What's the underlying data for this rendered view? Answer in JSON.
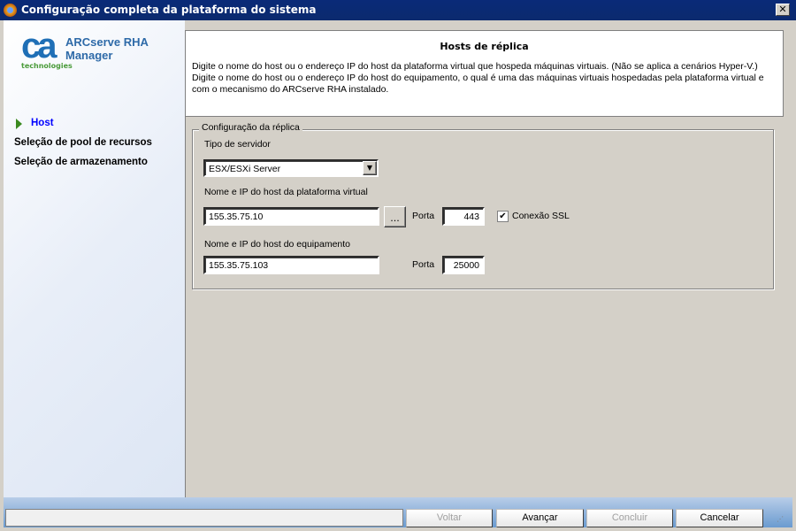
{
  "window": {
    "title": "Configuração completa da plataforma do sistema",
    "close": "✕"
  },
  "logo": {
    "brand": "ca",
    "sub": "technologies"
  },
  "product": {
    "line1": "ARCserve RHA",
    "line2": "Manager"
  },
  "steps": [
    {
      "label": "Host",
      "active": true
    },
    {
      "label": "Seleção de pool de recursos"
    },
    {
      "label": "Seleção de armazenamento"
    }
  ],
  "header": {
    "title": "Hosts de réplica",
    "description": "Digite o nome do host ou o endereço IP do host da plataforma virtual que hospeda máquinas virtuais. (Não se aplica a cenários Hyper-V.) Digite o nome do host ou o endereço IP do host do equipamento, o qual é uma das máquinas virtuais hospedadas pela plataforma virtual e com o mecanismo do ARCserve RHA instalado."
  },
  "group": {
    "title": "Configuração da réplica",
    "server_type_label": "Tipo de servidor",
    "server_type": "ESX/ESXi Server",
    "virtual_host_label": "Nome e IP do host da plataforma virtual",
    "virtual_host": "155.35.75.10",
    "browse": "...",
    "port_label": "Porta",
    "virtual_port": "443",
    "ssl_label": "Conexão SSL",
    "ssl_checked": true,
    "appliance_label": "Nome e IP do host do equipamento",
    "appliance_host": "155.35.75.103",
    "appliance_port": "25000"
  },
  "buttons": {
    "back": "Voltar",
    "next": "Avançar",
    "finish": "Concluir",
    "cancel": "Cancelar"
  },
  "colors": {
    "titlebar": "#0a2a78",
    "active_step": "#0000ff",
    "panel": "#d4d0c8"
  }
}
